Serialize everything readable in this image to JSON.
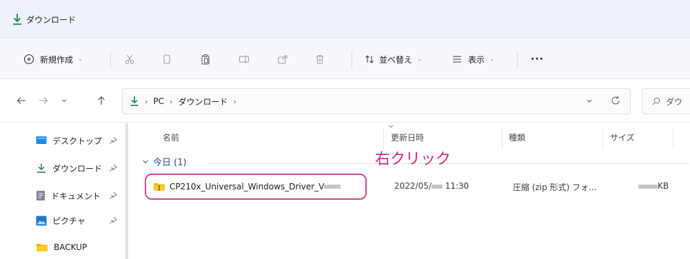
{
  "window": {
    "title": "ダウンロード"
  },
  "toolbar": {
    "new_label": "新規作成",
    "sort_label": "並べ替え",
    "view_label": "表示",
    "more_label": "···"
  },
  "address": {
    "segments": [
      "PC",
      "ダウンロード"
    ],
    "search_placeholder": "ダウ"
  },
  "sidebar": {
    "items": [
      {
        "label": "デスクトップ",
        "icon": "desktop-icon"
      },
      {
        "label": "ダウンロード",
        "icon": "download-icon"
      },
      {
        "label": "ドキュメント",
        "icon": "document-icon"
      },
      {
        "label": "ピクチャ",
        "icon": "picture-icon"
      },
      {
        "label": "BACKUP",
        "icon": "folder-icon"
      }
    ]
  },
  "columns": {
    "name": "名前",
    "date": "更新日時",
    "type": "種類",
    "size": "サイズ"
  },
  "group": {
    "label": "今日 (1)"
  },
  "annotation": {
    "text": "右クリック"
  },
  "files": [
    {
      "name": "CP210x_Universal_Windows_Driver_V",
      "date_prefix": "2022/05/",
      "time": "11:30",
      "type": "圧縮 (zip 形式) フォ...",
      "size_unit": "KB"
    }
  ],
  "colors": {
    "accent": "#3a8a3a",
    "annotation": "#d9237a",
    "highlight_border": "#d64590"
  }
}
